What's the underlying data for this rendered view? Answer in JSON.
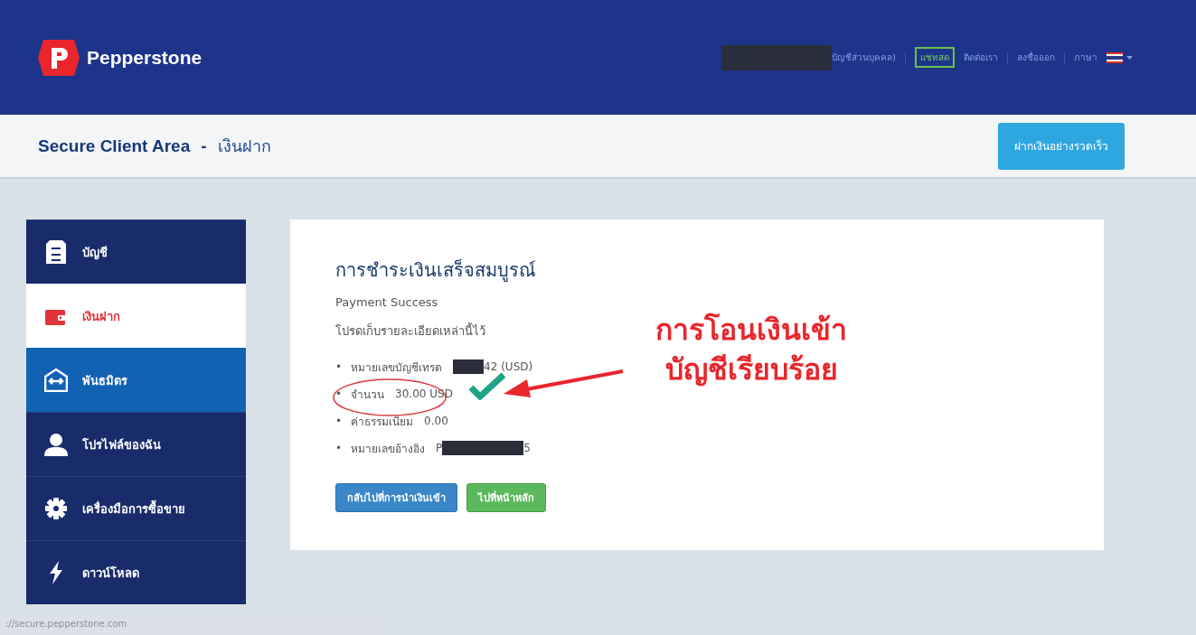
{
  "header": {
    "brand": "Pepperstone",
    "account_label": "บัญชีส่วนบุคคล)",
    "chat": "แชทสด",
    "links": [
      "ติดต่อเรา",
      "ลงชื่อออก"
    ],
    "language": "ภาษา"
  },
  "subheader": {
    "title": "Secure Client Area",
    "separator": "-",
    "page": "เงินฝาก",
    "quick_deposit": "ฝากเงินอย่างรวดเร็ว"
  },
  "sidebar": {
    "items": [
      {
        "label": "บัญชี",
        "selected": false,
        "highlighted": false
      },
      {
        "label": "เงินฝาก",
        "selected": true,
        "highlighted": false
      },
      {
        "label": "พันธมิตร",
        "selected": false,
        "highlighted": true
      },
      {
        "label": "โปรไฟล์ของฉัน",
        "selected": false,
        "highlighted": false
      },
      {
        "label": "เครื่องมือการซื้อขาย",
        "selected": false,
        "highlighted": false
      },
      {
        "label": "ดาวน์โหลด",
        "selected": false,
        "highlighted": false
      }
    ]
  },
  "card": {
    "title": "การชำระเงินเสร็จสมบูรณ์",
    "subtitle": "Payment Success",
    "note": "โปรดเก็บรายละเอียดเหล่านี้ไว้",
    "details": [
      {
        "bullet": "•",
        "label": "หมายเลขบัญชีเทรด",
        "redacted": true,
        "suffix": "42 (USD)",
        "circled": false
      },
      {
        "bullet": "•",
        "label": "จำนวน",
        "prefix": "30.00 USD",
        "redacted": false,
        "circled": true
      },
      {
        "bullet": "•",
        "label": "ค่าธรรมเนียม",
        "prefix": "0.00",
        "redacted": false,
        "circled": false
      },
      {
        "bullet": "•",
        "label": "หมายเลขอ้างอิง",
        "prefix": "P",
        "redacted": true,
        "suffix": "5",
        "circled": false
      }
    ],
    "buttons": [
      {
        "label": "กลับไปที่การนำเงินเข้า",
        "kind": "primary"
      },
      {
        "label": "ไปที่หน้าหลัก",
        "kind": "success"
      }
    ],
    "annotation": [
      "การโอนเงินเข้า",
      "บัญชีเรียบร้อย"
    ]
  },
  "status_bar": {
    "url": "://secure.pepperstone.com"
  }
}
